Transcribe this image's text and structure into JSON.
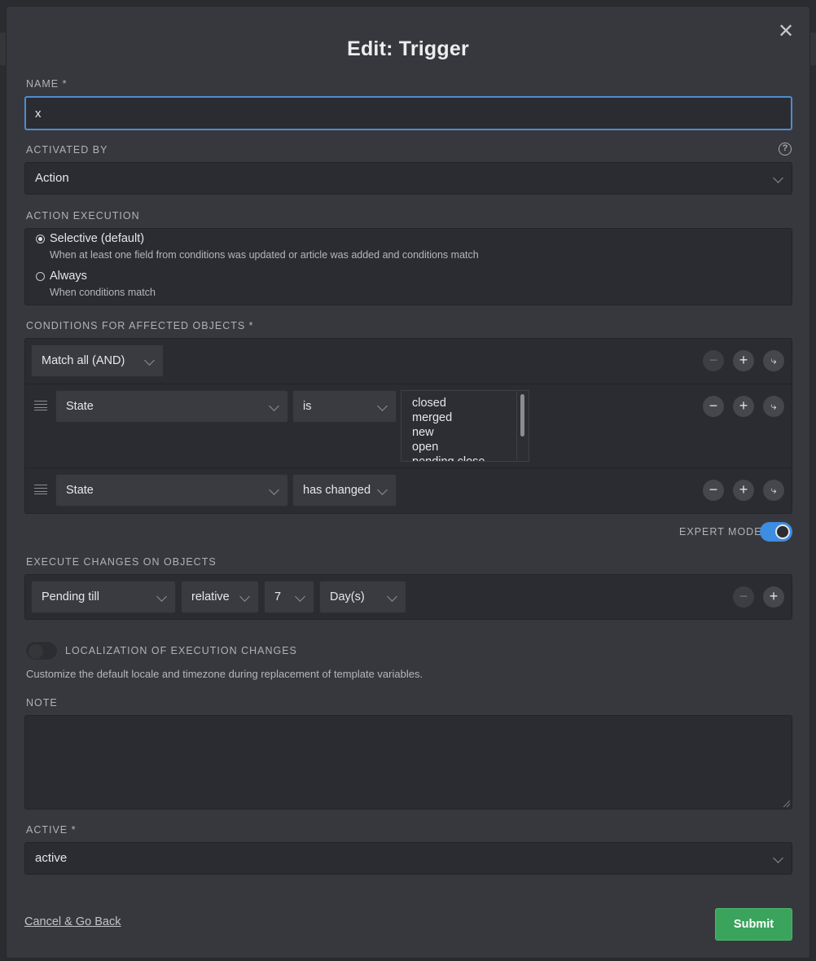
{
  "dialog": {
    "title": "Edit: Trigger",
    "close_icon": "close-icon"
  },
  "name": {
    "label": "NAME *",
    "value": "x"
  },
  "activated_by": {
    "label": "ACTIVATED BY",
    "value": "Action",
    "help_icon": "?"
  },
  "action_execution": {
    "label": "ACTION EXECUTION",
    "options": [
      {
        "label": "Selective (default)",
        "description": "When at least one field from conditions was updated or article was added and conditions match",
        "selected": true
      },
      {
        "label": "Always",
        "description": "When conditions match",
        "selected": false
      }
    ]
  },
  "conditions": {
    "label": "CONDITIONS FOR AFFECTED OBJECTS *",
    "match": "Match all (AND)",
    "rows": [
      {
        "attribute": "State",
        "operator": "is",
        "values": [
          "closed",
          "merged",
          "new",
          "open",
          "pending close"
        ]
      },
      {
        "attribute": "State",
        "operator": "has changed"
      }
    ],
    "buttons": {
      "remove": "−",
      "add": "+",
      "branch": "⤷"
    }
  },
  "expert_mode": {
    "label": "EXPERT MODE",
    "enabled": true
  },
  "execute_changes": {
    "label": "EXECUTE CHANGES ON OBJECTS",
    "attribute": "Pending till",
    "mode": "relative",
    "amount": "7",
    "unit": "Day(s)"
  },
  "localization": {
    "label": "LOCALIZATION OF EXECUTION CHANGES",
    "enabled": false,
    "description": "Customize the default locale and timezone during replacement of template variables."
  },
  "note": {
    "label": "NOTE",
    "value": ""
  },
  "active": {
    "label": "ACTIVE *",
    "value": "active"
  },
  "footer": {
    "cancel": "Cancel & Go Back",
    "submit": "Submit"
  },
  "colors": {
    "accent": "#3d8de0",
    "submit": "#3aa35c",
    "background": "#37383d"
  }
}
